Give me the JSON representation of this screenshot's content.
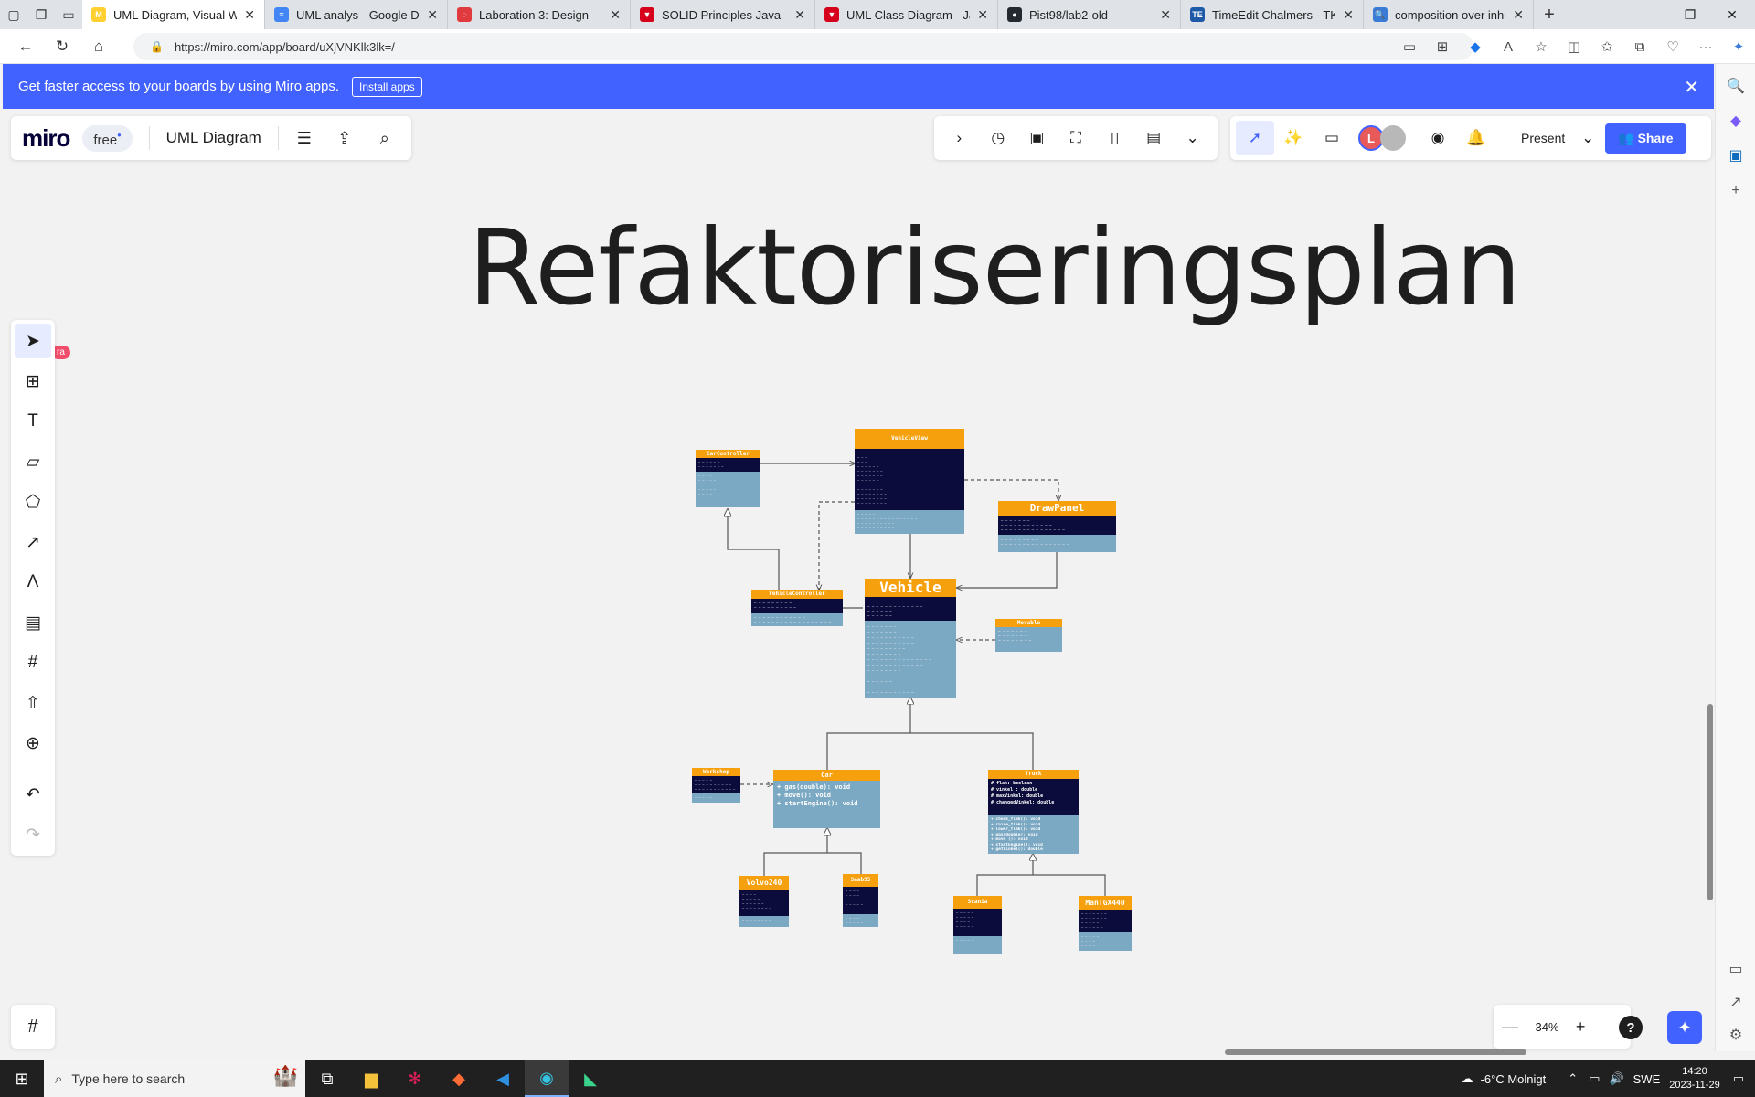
{
  "browser": {
    "tabs": [
      {
        "label": "UML Diagram, Visual Wo",
        "color": "#ffd02f",
        "glyph": "M",
        "active": true
      },
      {
        "label": "UML analys - Google Do",
        "color": "#4285f4",
        "glyph": "≡",
        "active": false
      },
      {
        "label": "Laboration 3: Design",
        "color": "#e0393e",
        "glyph": "◌",
        "active": false
      },
      {
        "label": "SOLID Principles Java - Ja",
        "color": "#d6001c",
        "glyph": "▼",
        "active": false
      },
      {
        "label": "UML Class Diagram - Jav",
        "color": "#d6001c",
        "glyph": "▼",
        "active": false
      },
      {
        "label": "Pist98/lab2-old",
        "color": "#24292f",
        "glyph": "●",
        "active": false
      },
      {
        "label": "TimeEdit Chalmers - TKIT",
        "color": "#1e5aa8",
        "glyph": "TE",
        "active": false
      },
      {
        "label": "composition over inherita",
        "color": "#3a7bd5",
        "glyph": "🔍",
        "active": false
      }
    ],
    "url": "https://miro.com/app/board/uXjVNKlk3lk=/"
  },
  "banner": {
    "text": "Get faster access to your boards by using Miro apps.",
    "install_label": "Install apps"
  },
  "miro": {
    "logo": "miro",
    "plan": "free",
    "board_name": "UML Diagram",
    "present_label": "Present",
    "share_label": "Share",
    "avatar_initial": "L",
    "zoom": "34%",
    "help": "?",
    "badge": "ra"
  },
  "board": {
    "title": "Refaktoriseringsplan",
    "classes": {
      "cartoroller": {
        "name": "CarController"
      },
      "vehicleview": {
        "name": "VehicleView"
      },
      "drawpanel": {
        "name": "DrawPanel"
      },
      "vehiclecontroller": {
        "name": "VehicleController"
      },
      "vehicle": {
        "name": "Vehicle"
      },
      "movable": {
        "name": "Movable"
      },
      "workshop": {
        "name": "Workshop"
      },
      "car": {
        "name": "Car",
        "methods": [
          "+ gas(double): void",
          "+ move(): void",
          "+ startEngine(): void"
        ]
      },
      "truck": {
        "name": "Truck",
        "attrs": [
          "# flak: boolean",
          "# vinkel : double",
          "# maxVinkel: double",
          "# changedVinkel: double"
        ],
        "methods": [
          "+ check_flak(): void",
          "+ raise_flak(): void",
          "+ lower_flak(): void",
          "+ gas(double): void",
          "+ move (): void",
          "+ startEngine(): void",
          "+ getVinkel(): double"
        ]
      },
      "volvo240": {
        "name": "Volvo240"
      },
      "saab95": {
        "name": "Saab95"
      },
      "scania": {
        "name": "Scania"
      },
      "mantgx440": {
        "name": "ManTGX440"
      }
    }
  },
  "taskbar": {
    "search_placeholder": "Type here to search",
    "weather": "-6°C  Molnigt",
    "lang": "SWE",
    "time": "14:20",
    "date": "2023-11-29"
  }
}
